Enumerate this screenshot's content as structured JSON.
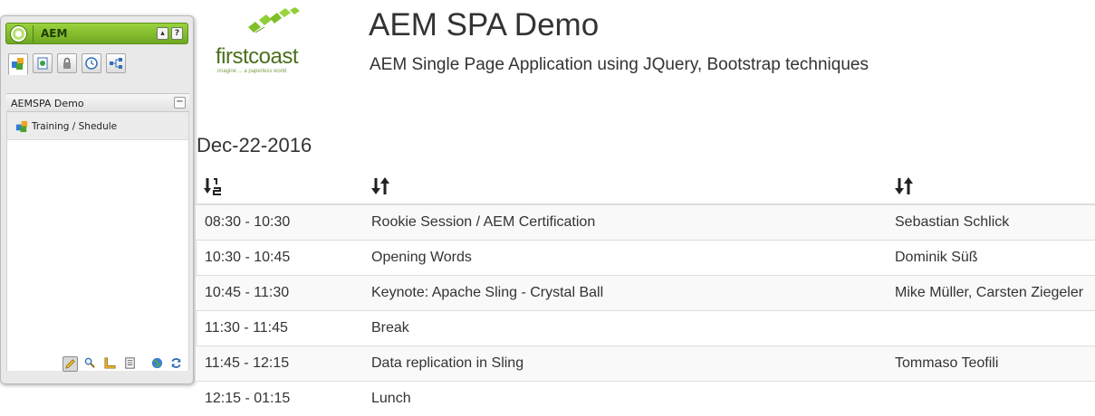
{
  "sidekick": {
    "title": "AEM",
    "page_section": "AEMSPA Demo",
    "items": [
      {
        "label": "Training / Shedule"
      }
    ]
  },
  "brand": {
    "word": "firstcoast",
    "tagline": "imagine ... a paperless world"
  },
  "page": {
    "title": "AEM SPA Demo",
    "subtitle": "AEM Single Page Application using JQuery, Bootstrap techniques"
  },
  "schedule": {
    "date": "Dec-22-2016",
    "rows": [
      {
        "time": "08:30 - 10:30",
        "title": "Rookie Session / AEM Certification",
        "speaker": "Sebastian Schlick"
      },
      {
        "time": "10:30 - 10:45",
        "title": "Opening Words",
        "speaker": "Dominik Süß"
      },
      {
        "time": "10:45 - 11:30",
        "title": "Keynote: Apache Sling - Crystal Ball",
        "speaker": "Mike Müller, Carsten Ziegeler"
      },
      {
        "time": "11:30 - 11:45",
        "title": "Break",
        "speaker": ""
      },
      {
        "time": "11:45 - 12:15",
        "title": "Data replication in Sling",
        "speaker": "Tommaso Teofili"
      },
      {
        "time": "12:15 - 01:15",
        "title": "Lunch",
        "speaker": ""
      }
    ]
  },
  "colors": {
    "sidekick_header": "#7ab82a",
    "brand_green": "#4a6f1d",
    "row_stripe": "#f9f9f9"
  },
  "icons": {
    "sort_numeric": "sort-numeric-icon",
    "sort": "sort-icon"
  }
}
